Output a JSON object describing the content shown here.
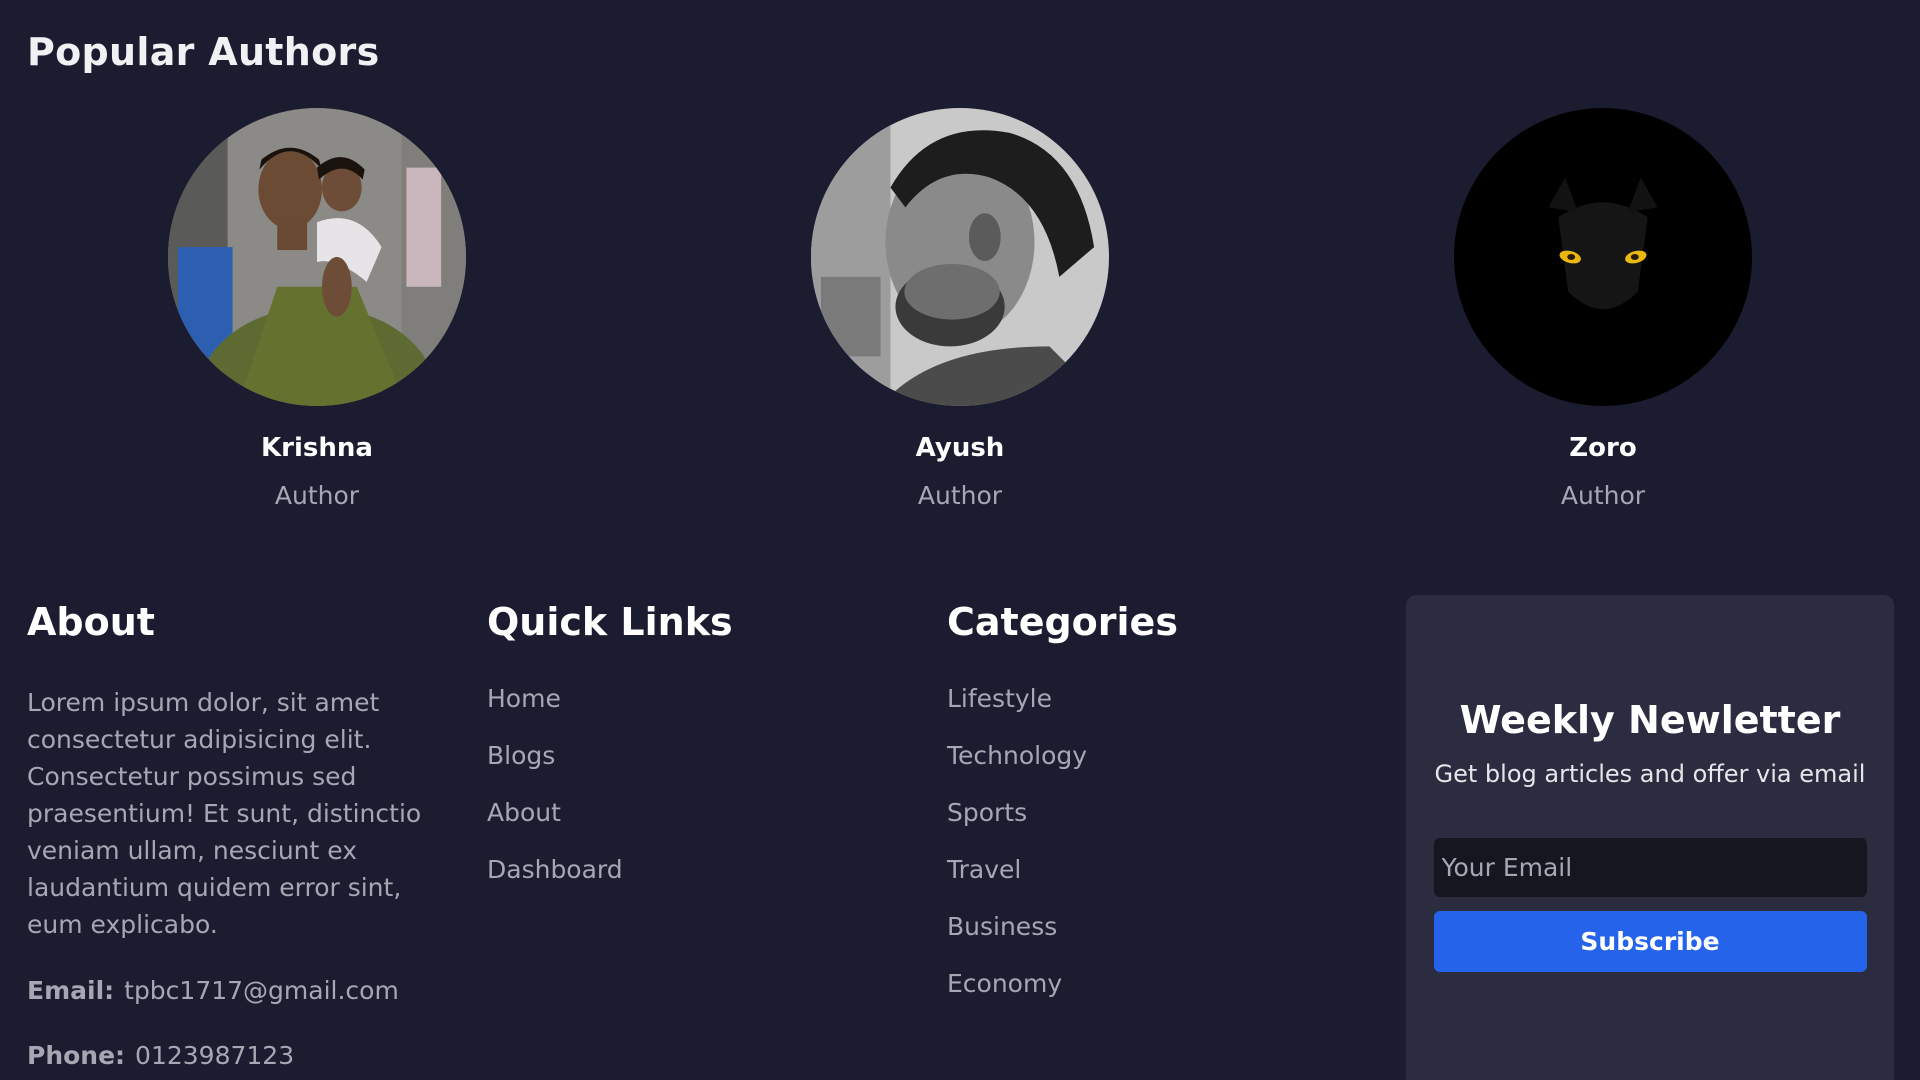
{
  "popular_authors": {
    "title": "Popular Authors",
    "authors": [
      {
        "name": "Krishna",
        "role": "Author",
        "avatar_icon": "avatar-photo-krishna"
      },
      {
        "name": "Ayush",
        "role": "Author",
        "avatar_icon": "avatar-photo-ayush"
      },
      {
        "name": "Zoro",
        "role": "Author",
        "avatar_icon": "avatar-photo-zoro"
      }
    ]
  },
  "footer": {
    "about": {
      "title": "About",
      "text": "Lorem ipsum dolor, sit amet consectetur adipisicing elit. Consectetur possimus sed praesentium! Et sunt, distinctio veniam ullam, nesciunt ex laudantium quidem error sint, eum explicabo.",
      "email_label": "Email:",
      "email_value": "tpbc1717@gmail.com",
      "phone_label": "Phone:",
      "phone_value": "0123987123"
    },
    "quick_links": {
      "title": "Quick Links",
      "items": [
        "Home",
        "Blogs",
        "About",
        "Dashboard"
      ]
    },
    "categories": {
      "title": "Categories",
      "items": [
        "Lifestyle",
        "Technology",
        "Sports",
        "Travel",
        "Business",
        "Economy"
      ]
    },
    "newsletter": {
      "title": "Weekly Newletter",
      "subtitle": "Get blog articles and offer via email",
      "email_placeholder": "Your Email",
      "button_label": "Subscribe"
    }
  },
  "colors": {
    "background": "#1b1c30",
    "card_background": "#2b2c3f",
    "muted_text": "#a6a7b3",
    "input_background": "#15161f",
    "accent_blue": "#2563eb"
  }
}
